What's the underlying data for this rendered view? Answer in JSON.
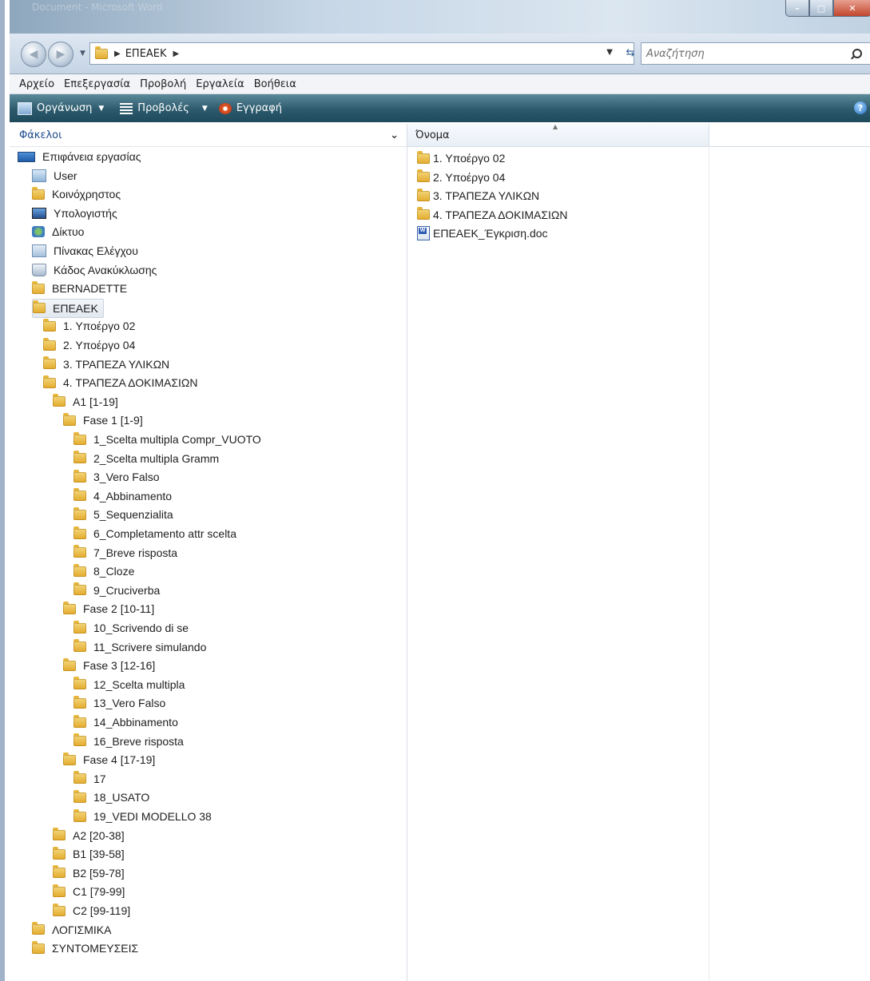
{
  "window": {
    "title": "Document - Microsoft Word",
    "controls": {
      "minimize": "–",
      "maximize": "□",
      "close": "✕"
    }
  },
  "address": {
    "breadcrumb": [
      "ΕΠΕΑΕΚ"
    ],
    "search_placeholder": "Αναζήτηση"
  },
  "menu": [
    "Αρχείο",
    "Επεξεργασία",
    "Προβολή",
    "Εργαλεία",
    "Βοήθεια"
  ],
  "commands": {
    "organize": "Οργάνωση",
    "views": "Προβολές",
    "burn": "Εγγραφή"
  },
  "folders_pane": {
    "title": "Φάκελοι",
    "tree": [
      {
        "label": "Επιφάνεια εργασίας",
        "icon": "desktop-icon",
        "level": 0
      },
      {
        "label": "User",
        "icon": "user-icon",
        "level": 1
      },
      {
        "label": "Κοινόχρηστος",
        "icon": "folder-icon",
        "level": 1
      },
      {
        "label": "Υπολογιστής",
        "icon": "computer-icon",
        "level": 1
      },
      {
        "label": "Δίκτυο",
        "icon": "network-icon",
        "level": 1
      },
      {
        "label": "Πίνακας Ελέγχου",
        "icon": "control-panel-icon",
        "level": 1
      },
      {
        "label": "Κάδος Ανακύκλωσης",
        "icon": "recycle-bin-icon",
        "level": 1
      },
      {
        "label": "BERNADETTE",
        "icon": "folder-icon",
        "level": 1
      },
      {
        "label": "ΕΠΕΑΕΚ",
        "icon": "folder-icon",
        "level": 1,
        "selected": true
      },
      {
        "label": "1. Υποέργο 02",
        "icon": "folder-icon",
        "level": 2
      },
      {
        "label": "2. Υποέργο 04",
        "icon": "folder-icon",
        "level": 2
      },
      {
        "label": "3. ΤΡΑΠΕΖΑ ΥΛΙΚΩΝ",
        "icon": "folder-icon",
        "level": 2
      },
      {
        "label": "4. ΤΡΑΠΕΖΑ ΔΟΚΙΜΑΣΙΩΝ",
        "icon": "folder-icon",
        "level": 2
      },
      {
        "label": "A1 [1-19]",
        "icon": "folder-icon",
        "level": 3
      },
      {
        "label": "Fase 1  [1-9]",
        "icon": "folder-icon",
        "level": 4
      },
      {
        "label": "1_Scelta multipla Compr_VUOTO",
        "icon": "folder-icon",
        "level": 5
      },
      {
        "label": "2_Scelta multipla Gramm",
        "icon": "folder-icon",
        "level": 5
      },
      {
        "label": "3_Vero Falso",
        "icon": "folder-icon",
        "level": 5
      },
      {
        "label": "4_Abbinamento",
        "icon": "folder-icon",
        "level": 5
      },
      {
        "label": "5_Sequenzialita",
        "icon": "folder-icon",
        "level": 5
      },
      {
        "label": "6_Completamento attr scelta",
        "icon": "folder-icon",
        "level": 5
      },
      {
        "label": "7_Breve risposta",
        "icon": "folder-icon",
        "level": 5
      },
      {
        "label": "8_Cloze",
        "icon": "folder-icon",
        "level": 5
      },
      {
        "label": "9_Cruciverba",
        "icon": "folder-icon",
        "level": 5
      },
      {
        "label": "Fase 2  [10-11]",
        "icon": "folder-icon",
        "level": 4
      },
      {
        "label": "10_Scrivendo di se",
        "icon": "folder-icon",
        "level": 5
      },
      {
        "label": "11_Scrivere simulando",
        "icon": "folder-icon",
        "level": 5
      },
      {
        "label": "Fase 3  [12-16]",
        "icon": "folder-icon",
        "level": 4
      },
      {
        "label": "12_Scelta multipla",
        "icon": "folder-icon",
        "level": 5
      },
      {
        "label": "13_Vero Falso",
        "icon": "folder-icon",
        "level": 5
      },
      {
        "label": "14_Abbinamento",
        "icon": "folder-icon",
        "level": 5
      },
      {
        "label": "16_Breve risposta",
        "icon": "folder-icon",
        "level": 5
      },
      {
        "label": "Fase 4  [17-19]",
        "icon": "folder-icon",
        "level": 4
      },
      {
        "label": "17",
        "icon": "folder-icon",
        "level": 5
      },
      {
        "label": "18_USATO",
        "icon": "folder-icon",
        "level": 5
      },
      {
        "label": "19_VEDI MODELLO 38",
        "icon": "folder-icon",
        "level": 5
      },
      {
        "label": "A2  [20-38]",
        "icon": "folder-icon",
        "level": 3
      },
      {
        "label": "B1  [39-58]",
        "icon": "folder-icon",
        "level": 3
      },
      {
        "label": "B2  [59-78]",
        "icon": "folder-icon",
        "level": 3
      },
      {
        "label": "C1  [79-99]",
        "icon": "folder-icon",
        "level": 3
      },
      {
        "label": "C2  [99-119]",
        "icon": "folder-icon",
        "level": 3
      },
      {
        "label": "ΛΟΓΙΣΜΙΚΑ",
        "icon": "folder-icon",
        "level": 1
      },
      {
        "label": "ΣΥΝΤΟΜΕΥΣΕΙΣ",
        "icon": "folder-icon",
        "level": 1
      }
    ]
  },
  "file_list": {
    "column_name": "Όνομα",
    "items": [
      {
        "name": "1. Υποέργο 02",
        "icon": "folder-icon"
      },
      {
        "name": "2. Υποέργο 04",
        "icon": "folder-icon"
      },
      {
        "name": "3. ΤΡΑΠΕΖΑ ΥΛΙΚΩΝ",
        "icon": "folder-icon"
      },
      {
        "name": "4. ΤΡΑΠΕΖΑ ΔΟΚΙΜΑΣΙΩΝ",
        "icon": "folder-icon"
      },
      {
        "name": "ΕΠΕΑΕΚ_Έγκριση.doc",
        "icon": "word-document-icon"
      }
    ]
  }
}
